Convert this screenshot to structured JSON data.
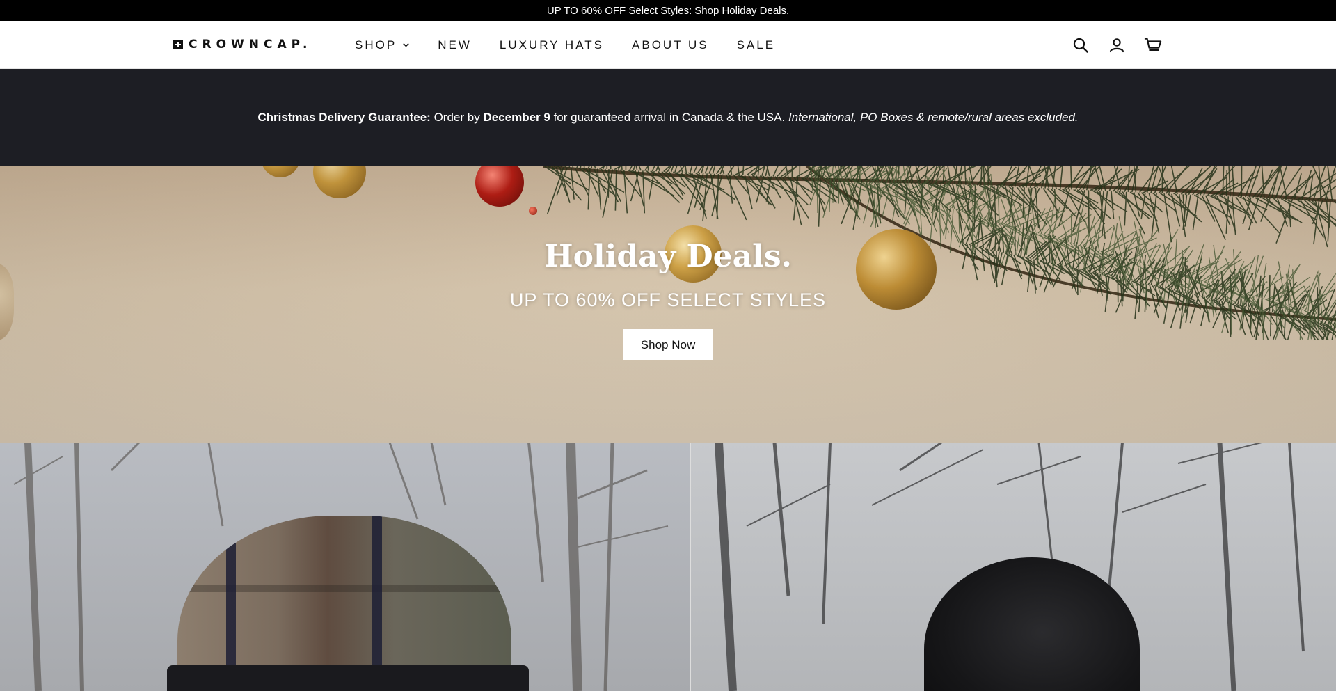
{
  "announcement": {
    "text": "UP TO 60% OFF Select Styles:",
    "link": "Shop Holiday Deals."
  },
  "header": {
    "logo": "CROWNCAP.",
    "nav": [
      {
        "label": "SHOP",
        "has_dropdown": true
      },
      {
        "label": "NEW"
      },
      {
        "label": "LUXURY HATS"
      },
      {
        "label": "ABOUT US"
      },
      {
        "label": "SALE"
      }
    ],
    "icons": [
      "search-icon",
      "account-icon",
      "cart-icon"
    ]
  },
  "notice": {
    "bold_lead": "Christmas Delivery Guarantee:",
    "text1": "Order by",
    "date": "December 9",
    "text2": "for guaranteed arrival in Canada & the USA.",
    "italic": "International, PO Boxes & remote/rural areas excluded."
  },
  "hero": {
    "title": "Holiday Deals.",
    "subtitle": "UP TO 60% OFF SELECT STYLES",
    "button": "Shop Now"
  },
  "colors": {
    "announce_bg": "#000000",
    "notice_bg": "#1d1e24",
    "hero_btn_bg": "#ffffff"
  }
}
